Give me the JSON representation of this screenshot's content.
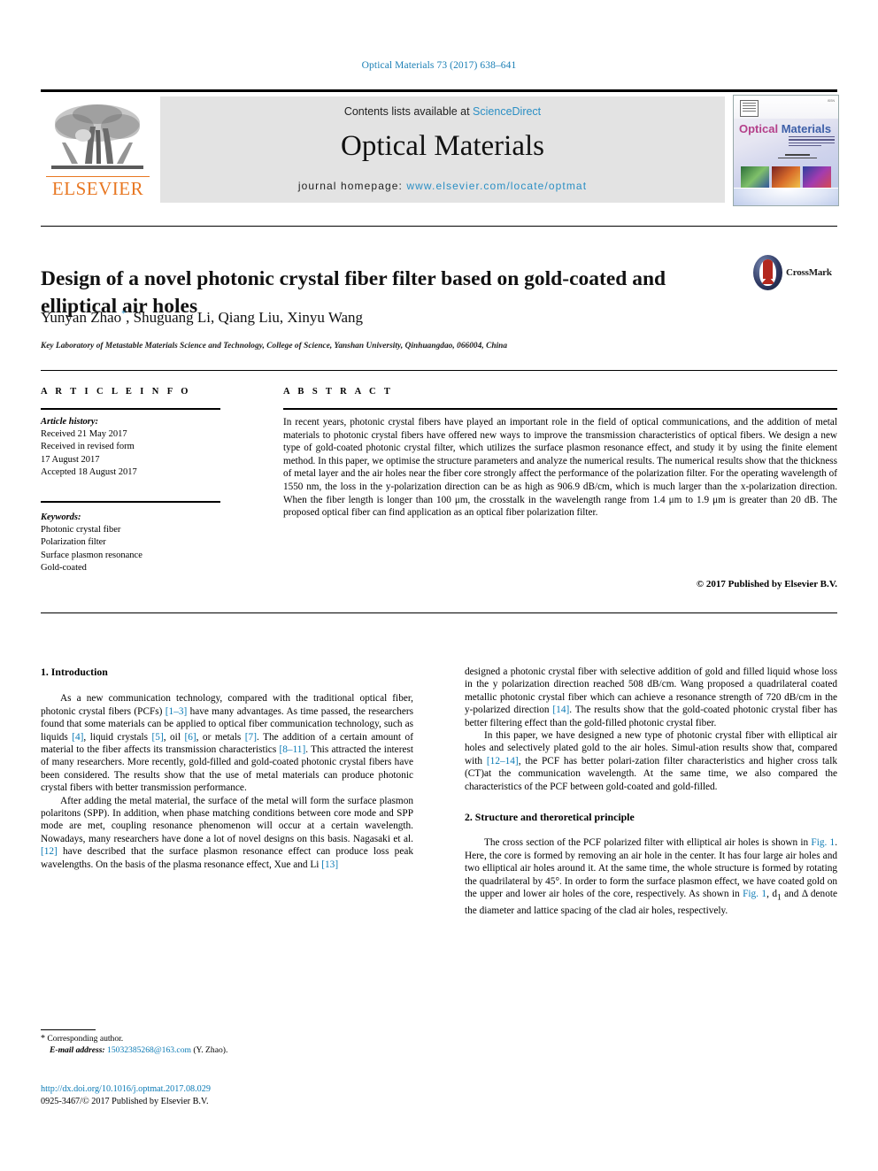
{
  "running_head": "Optical Materials 73 (2017) 638–641",
  "masthead": {
    "contents_prefix": "Contents lists available at ",
    "sciencedirect": "ScienceDirect",
    "journal_name": "Optical Materials",
    "homepage_prefix": "journal homepage: ",
    "homepage_url": "www.elsevier.com/locate/optmat",
    "publisher_logo_text": "ELSEVIER",
    "cover_title_1": "Optical",
    "cover_title_2": "Materials"
  },
  "article": {
    "title": "Design of a novel photonic crystal fiber filter based on gold-coated and elliptical air holes",
    "crossmark_label": "CrossMark",
    "authors": "Yunyan Zhao, Shuguang Li, Qiang Liu, Xinyu Wang",
    "authors_first": "Yunyan Zhao",
    "authors_rest": ", Shuguang Li, Qiang Liu, Xinyu Wang",
    "corresponding_marker": "*",
    "affiliation": "Key Laboratory of Metastable Materials Science and Technology, College of Science, Yanshan University, Qinhuangdao, 066004, China"
  },
  "info": {
    "heading": "A R T I C L E   I N F O",
    "history_label": "Article history:",
    "history": [
      "Received 21 May 2017",
      "Received in revised form",
      "17 August 2017",
      "Accepted 18 August 2017"
    ],
    "keywords_label": "Keywords:",
    "keywords": [
      "Photonic crystal fiber",
      "Polarization filter",
      "Surface plasmon resonance",
      "Gold-coated"
    ]
  },
  "abstract": {
    "heading": "A B S T R A C T",
    "text": "In recent years, photonic crystal fibers have played an important role in the field of optical communications, and the addition of metal materials to photonic crystal fibers have offered new ways to improve the transmission characteristics of optical fibers. We design a new type of gold-coated photonic crystal filter, which utilizes the surface plasmon resonance effect, and study it by using the finite element method. In this paper, we optimise the structure parameters and analyze the numerical results. The numerical results show that the thickness of metal layer and the air holes near the fiber core strongly affect the performance of the polarization filter. For the operating wavelength of 1550 nm, the loss in the y-polarization direction can be as high as 906.9 dB/cm, which is much larger than the x-polarization direction. When the fiber length is longer than 100 μm, the crosstalk in the wavelength range from 1.4 μm to 1.9 μm is greater than 20 dB. The proposed optical fiber can find application as an optical fiber polarization filter.",
    "copyright": "© 2017 Published by Elsevier B.V."
  },
  "body": {
    "section1_heading": "1. Introduction",
    "section2_heading": "2. Structure and theroretical principle",
    "left_p1_a": "As a new communication technology, compared with the traditional optical fiber, photonic crystal fibers (PCFs) ",
    "left_p1_r1": "[1–3]",
    "left_p1_b": " have many advantages. As time passed, the researchers found that some materials can be applied to optical fiber communication technology, such as liquids ",
    "left_p1_r2": "[4]",
    "left_p1_c": ", liquid crystals ",
    "left_p1_r3": "[5]",
    "left_p1_d": ", oil ",
    "left_p1_r4": "[6]",
    "left_p1_e": ", or metals ",
    "left_p1_r5": "[7]",
    "left_p1_f": ". The addition of a certain amount of material to the fiber affects its transmission characteristics ",
    "left_p1_r6": "[8–11]",
    "left_p1_g": ". This attracted the interest of many researchers. More recently, gold-filled and gold-coated photonic crystal fibers have been considered. The results show that the use of metal materials can produce photonic crystal fibers with better transmission performance.",
    "left_p2_a": "After adding the metal material, the surface of the metal will form the surface plasmon polaritons (SPP). In addition, when phase matching conditions between core mode and SPP mode are met, coupling resonance phenomenon will occur at a certain wavelength. Nowadays, many researchers have done a lot of novel designs on this basis. Nagasaki et al. ",
    "left_p2_r1": "[12]",
    "left_p2_b": " have described that the surface plasmon resonance effect can produce loss peak wavelengths. On the basis of the plasma resonance effect, Xue and Li ",
    "left_p2_r2": "[13]",
    "right_p1_a": "designed a photonic crystal fiber with selective addition of gold and filled liquid whose loss in the y polarization direction reached 508 dB/cm. Wang proposed a quadrilateral coated metallic photonic crystal fiber which can achieve a resonance strength of 720 dB/cm in the y-polarized direction ",
    "right_p1_r1": "[14]",
    "right_p1_b": ". The results show that the gold-coated photonic crystal fiber has better filtering effect than the gold-filled photonic crystal fiber.",
    "right_p2_a": "In this paper, we have designed a new type of photonic crystal fiber with elliptical air holes and selectively plated gold to the air holes. Simul-ation results show that, compared with ",
    "right_p2_r1": "[12–14]",
    "right_p2_b": ", the PCF has better polari-zation filter characteristics and higher cross talk (CT)at the communication wavelength. At the same time, we also compared the characteristics of the PCF between gold-coated and gold-filled.",
    "right_p3_a": "The cross section of the PCF polarized filter with elliptical air holes is shown in ",
    "right_p3_fig1": "Fig. 1",
    "right_p3_b": ". Here, the core is formed by removing an air hole in the center. It has four large air holes and two elliptical air holes around it. At the same time, the whole structure is formed by rotating the quadrilateral by 45°. In order to form the surface plasmon effect, we have coated gold on the upper and lower air holes of the core, respectively. As shown in ",
    "right_p3_fig2": "Fig. 1",
    "right_p3_c": ", d",
    "right_p3_sub": "1",
    "right_p3_d": " and Δ denote the diameter and lattice spacing of the clad air holes, respectively."
  },
  "footnote": {
    "star": "*",
    "corresponding": " Corresponding author.",
    "email_label": "E-mail address:",
    "email": "15032385268@163.com",
    "email_suffix": " (Y. Zhao)."
  },
  "footer": {
    "doi": "http://dx.doi.org/10.1016/j.optmat.2017.08.029",
    "issn_line": "0925-3467/© 2017 Published by Elsevier B.V."
  },
  "colors": {
    "link": "#0b7ab5",
    "elsevier_orange": "#E87722",
    "masthead_bg": "#e3e3e3"
  }
}
